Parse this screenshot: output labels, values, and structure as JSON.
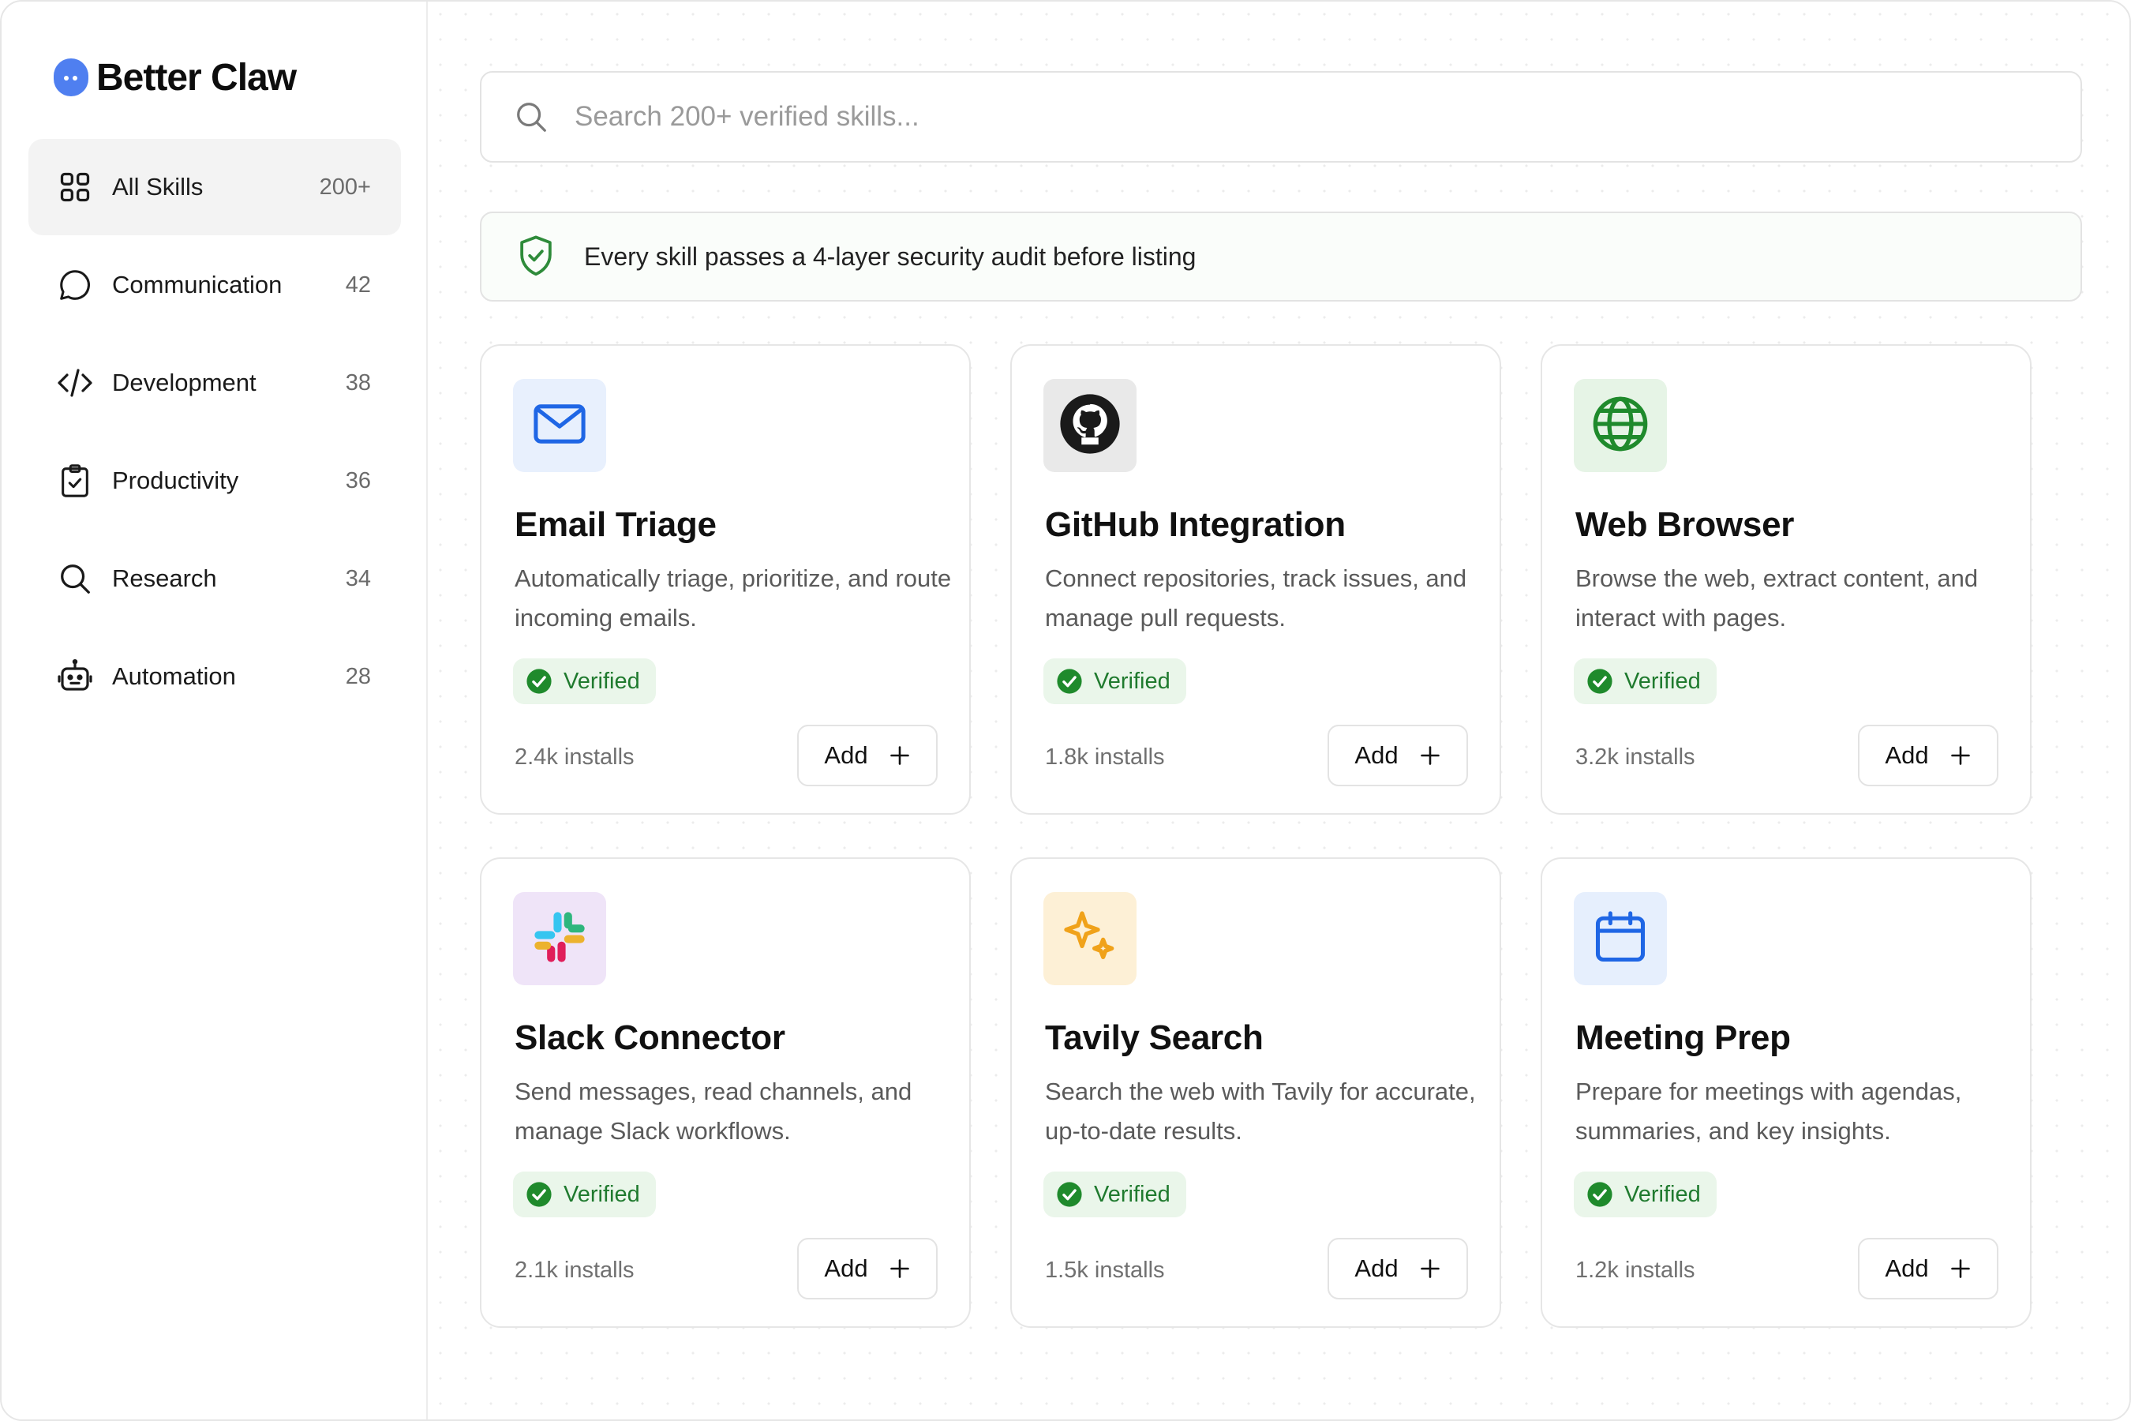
{
  "brand": {
    "name": "Better Claw",
    "logo_color": "#4f7ff0"
  },
  "sidebar": {
    "items": [
      {
        "key": "all-skills",
        "label": "All Skills",
        "count": "200+",
        "icon": "grid-icon",
        "active": true
      },
      {
        "key": "communication",
        "label": "Communication",
        "count": "42",
        "icon": "chat-bubble-icon",
        "active": false
      },
      {
        "key": "development",
        "label": "Development",
        "count": "38",
        "icon": "code-icon",
        "active": false
      },
      {
        "key": "productivity",
        "label": "Productivity",
        "count": "36",
        "icon": "clipboard-check-icon",
        "active": false
      },
      {
        "key": "research",
        "label": "Research",
        "count": "34",
        "icon": "magnifier-icon",
        "active": false
      },
      {
        "key": "automation",
        "label": "Automation",
        "count": "28",
        "icon": "robot-icon",
        "active": false
      }
    ]
  },
  "search": {
    "placeholder": "Search 200+ verified skills..."
  },
  "notice": {
    "text": "Every skill passes a 4-layer security audit before listing",
    "icon": "shield-check-icon",
    "accent": "#2e8b3a"
  },
  "skills": [
    {
      "title": "Email Triage",
      "description": "Automatically triage, prioritize, and route incoming emails.",
      "badge": "Verified",
      "installs": "2.4k installs",
      "add_label": "Add",
      "icon": "mail-icon",
      "icon_bg": "#e8f0fd",
      "icon_color": "#1f66e5"
    },
    {
      "title": "GitHub Integration",
      "description": "Connect repositories, track issues, and manage pull requests.",
      "badge": "Verified",
      "installs": "1.8k installs",
      "add_label": "Add",
      "icon": "github-icon",
      "icon_bg": "#e9e9e9",
      "icon_color": "#1a1a1a"
    },
    {
      "title": "Web Browser",
      "description": "Browse the web, extract content, and interact with pages.",
      "badge": "Verified",
      "installs": "3.2k installs",
      "add_label": "Add",
      "icon": "globe-icon",
      "icon_bg": "#e6f4e6",
      "icon_color": "#1f8a2c"
    },
    {
      "title": "Slack Connector",
      "description": "Send messages, read channels, and manage Slack workflows.",
      "badge": "Verified",
      "installs": "2.1k installs",
      "add_label": "Add",
      "icon": "slack-icon",
      "icon_bg": "#efe4f8",
      "icon_color": "#4a154b"
    },
    {
      "title": "Tavily Search",
      "description": "Search the web with Tavily for accurate, up-to-date results.",
      "badge": "Verified",
      "installs": "1.5k installs",
      "add_label": "Add",
      "icon": "sparkle-icon",
      "icon_bg": "#fdf0d6",
      "icon_color": "#f0a21a"
    },
    {
      "title": "Meeting Prep",
      "description": "Prepare for meetings with agendas, summaries, and key insights.",
      "badge": "Verified",
      "installs": "1.2k installs",
      "add_label": "Add",
      "icon": "calendar-icon",
      "icon_bg": "#e6effd",
      "icon_color": "#1f66e5"
    }
  ],
  "colors": {
    "verified_text": "#1f7a2e",
    "verified_bg": "#eaf6ea",
    "verified_icon": "#1f8a2c"
  }
}
